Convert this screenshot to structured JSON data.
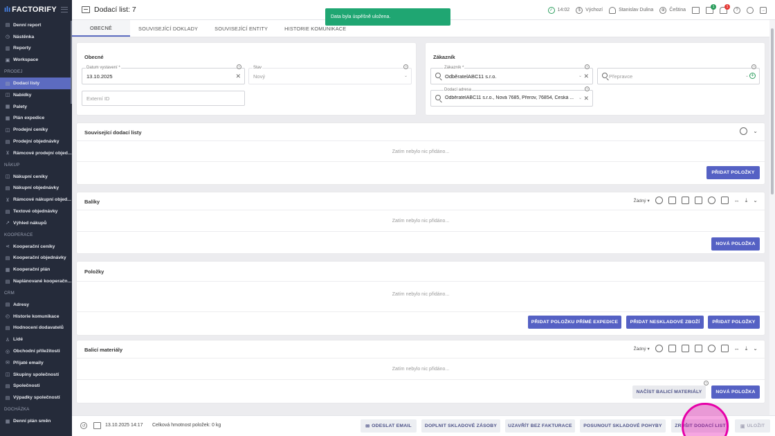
{
  "brand": {
    "logo_text": "FACTORIFY"
  },
  "sidebar": {
    "items": [
      {
        "label": "Denní report",
        "icon": "report-icon"
      },
      {
        "label": "Nástěnka",
        "icon": "dashboard-icon"
      },
      {
        "label": "Reporty",
        "icon": "chart-icon"
      },
      {
        "label": "Workspace",
        "icon": "workspace-icon"
      },
      {
        "section": "PRODEJ"
      },
      {
        "label": "Dodací listy",
        "icon": "document-icon",
        "active": true
      },
      {
        "label": "Nabídky",
        "icon": "offer-icon"
      },
      {
        "label": "Palety",
        "icon": "pallet-icon"
      },
      {
        "label": "Plán expedice",
        "icon": "calendar-icon"
      },
      {
        "label": "Prodejní ceníky",
        "icon": "price-icon"
      },
      {
        "label": "Prodejní objednávky",
        "icon": "order-icon"
      },
      {
        "label": "Rámcové prodejní objed...",
        "icon": "cart-icon"
      },
      {
        "section": "NÁKUP"
      },
      {
        "label": "Nákupní ceníky",
        "icon": "price-icon"
      },
      {
        "label": "Nákupní objednávky",
        "icon": "order-icon"
      },
      {
        "label": "Rámcové nákupní objed...",
        "icon": "cart-icon"
      },
      {
        "label": "Textové objednávky",
        "icon": "text-icon"
      },
      {
        "label": "Výhled nákupů",
        "icon": "trend-icon"
      },
      {
        "section": "KOOPERACE"
      },
      {
        "label": "Kooperační ceníky",
        "icon": "share-icon"
      },
      {
        "label": "Kooperační objednávky",
        "icon": "order-icon"
      },
      {
        "label": "Kooperační plán",
        "icon": "calendar-icon"
      },
      {
        "label": "Naplánované kooperačn...",
        "icon": "document-icon"
      },
      {
        "section": "CRM"
      },
      {
        "label": "Adresy",
        "icon": "address-icon"
      },
      {
        "label": "Historie komunikace",
        "icon": "history-icon"
      },
      {
        "label": "Hodnocení dodavatelů",
        "icon": "rating-icon"
      },
      {
        "label": "Lidé",
        "icon": "person-icon"
      },
      {
        "label": "Obchodní příležitosti",
        "icon": "handshake-icon"
      },
      {
        "label": "Přijaté emaily",
        "icon": "mail-icon"
      },
      {
        "label": "Skupiny společností",
        "icon": "group-icon"
      },
      {
        "label": "Společnosti",
        "icon": "company-icon"
      },
      {
        "label": "Výpadky společností",
        "icon": "outage-icon"
      },
      {
        "section": "DOCHÁZKA"
      },
      {
        "label": "Denní plán směn",
        "icon": "shift-icon"
      }
    ]
  },
  "header": {
    "title": "Dodací list: 7",
    "time": "14:02",
    "currency": "Výchozí",
    "user": "Stanislav Dulina",
    "language": "Čeština",
    "badge_green": "1",
    "badge_red": "1"
  },
  "toast": {
    "message": "Data byla úspěšně uložena."
  },
  "tabs": [
    "OBECNÉ",
    "SOUVISEJÍCÍ DOKLADY",
    "SOUVISEJÍCÍ ENTITY",
    "HISTORIE KOMUNIKACE"
  ],
  "general": {
    "title": "Obecné",
    "date_label": "Datum vystavení *",
    "date_value": "13.10.2025",
    "state_label": "Stav",
    "state_value": "Nový",
    "external_id_placeholder": "Externí ID"
  },
  "customer": {
    "title": "Zákazník",
    "customer_label": "Zákazník *",
    "customer_value": "OdběratelABC11 s.r.o.",
    "carrier_placeholder": "Přepravce",
    "address_label": "Dodací adresa",
    "address_value": "OdběratelABC11 s.r.o., Nová 7685, Přerov, 76854, Česká ..."
  },
  "sections": {
    "related": {
      "title": "Související dodací listy",
      "empty": "Zatím nebylo nic přidáno...",
      "button": "PŘIDAT POLOŽKY"
    },
    "packages": {
      "title": "Balíky",
      "filter": "Žádný",
      "empty": "Zatím nebylo nic přidáno...",
      "button": "NOVÁ POLOŽKA"
    },
    "items": {
      "title": "Položky",
      "empty": "Zatím nebylo nic přidáno...",
      "btn1": "PŘIDAT POLOŽKU PŘÍMÉ EXPEDICE",
      "btn2": "PŘIDAT NESKLADOVÉ ZBOŽÍ",
      "btn3": "PŘIDAT POLOŽKY"
    },
    "packing": {
      "title": "Balicí materiály",
      "filter": "Žádný",
      "empty": "Zatím nebylo nic přidáno...",
      "btn1": "NAČÍST BALICÍ MATERIÁLY",
      "btn2": "NOVÁ POLOŽKA"
    }
  },
  "footer": {
    "timestamp": "13.10.2025 14:17",
    "weight": "Celková hmotnost položek: 0 kg",
    "send_email": "ODESLAT EMAIL",
    "restock": "DOPLNIT SKLADOVÉ ZÁSOBY",
    "close_no_invoice": "UZAVŘÍT BEZ FAKTURACE",
    "move_stock": "POSUNOUT SKLADOVÉ POHYBY",
    "cancel_note": "ZRUŠIT DODACÍ LIST",
    "save": "ULOŽIT"
  },
  "colors": {
    "accent": "#5561c4",
    "toast": "#1fa672",
    "sidebar": "#252b3a",
    "highlight": "#e600a8"
  }
}
